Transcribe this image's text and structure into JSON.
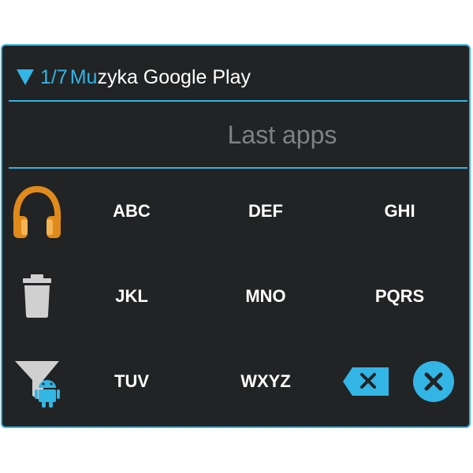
{
  "header": {
    "counter": "1/7",
    "app_match": "Mu",
    "app_rest": "zyka Google Play"
  },
  "search": {
    "placeholder": "Last apps",
    "value": ""
  },
  "keypad": {
    "row1": [
      "ABC",
      "DEF",
      "GHI"
    ],
    "row2": [
      "JKL",
      "MNO",
      "PQRS"
    ],
    "row3": [
      "TUV",
      "WXYZ"
    ]
  },
  "icons": {
    "collapse": "triangle-down-icon",
    "app": "headphones-icon",
    "delete": "trash-icon",
    "filter": "filter-android-icon",
    "backspace": "backspace-icon",
    "close": "close-circle-icon"
  },
  "colors": {
    "accent": "#33b5e5",
    "background": "#212325",
    "text": "#ffffff",
    "hint": "#7f8184",
    "headphones": "#e08a1c"
  }
}
